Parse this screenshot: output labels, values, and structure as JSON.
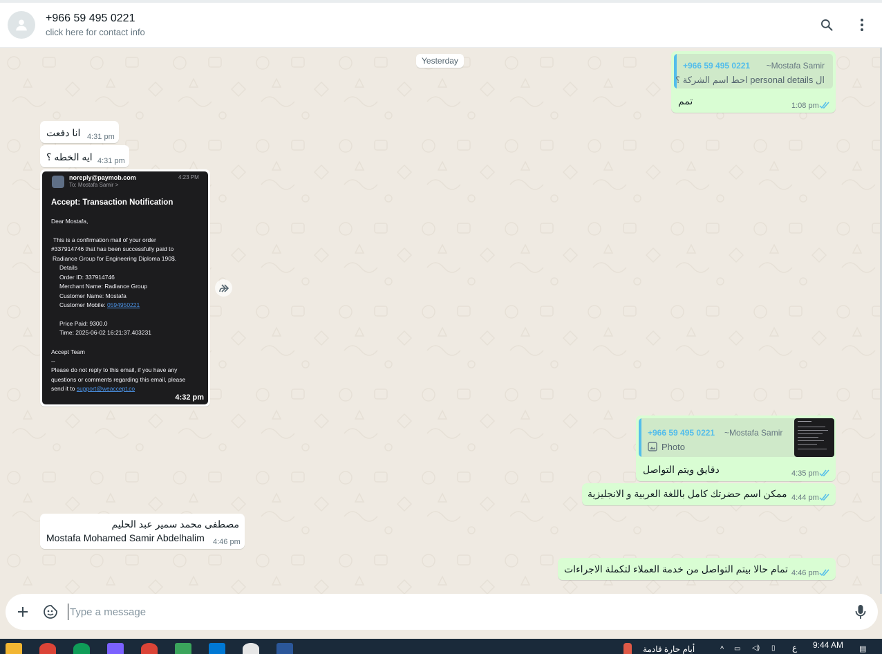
{
  "header": {
    "contact_name": "+966 59 495 0221",
    "contact_sub": "click here for contact info",
    "search_icon": "search-icon",
    "menu_icon": "kebab-menu-icon"
  },
  "chat": {
    "day_label": "Yesterday",
    "messages": [
      {
        "direction": "out",
        "quote_phone": "+966 59 495 0221",
        "quote_author": "~Mostafa Samir",
        "quote_text": "ال personal details احط اسم الشركة ؟",
        "text": "تمم",
        "time": "1:08 pm"
      },
      {
        "direction": "in",
        "text": "انا دفعت",
        "time": "4:31 pm"
      },
      {
        "direction": "in",
        "text": "ايه الخطه ؟",
        "time": "4:31 pm"
      },
      {
        "direction": "in",
        "type": "image",
        "time": "4:32 pm",
        "email": {
          "from": "noreply@paymob.com",
          "to": "To: Mostafa Samir >",
          "stamp": "4:23 PM",
          "subject": "Accept: Transaction Notification",
          "greeting": "Dear Mostafa,",
          "line1": "This is a confirmation mail of your order",
          "line2": "#337914746 that has been successfully paid to",
          "line3": "Radiance Group for Engineering Diploma 190$.",
          "details": "Details",
          "order_id": "Order ID: 337914746",
          "merchant": "Merchant Name: Radiance Group",
          "customer": "Customer Name: Mostafa",
          "mobile_label": "Customer Mobile: ",
          "mobile": "0594950221",
          "price": "Price Paid: 9300.0",
          "time_line": "Time: 2025-06-02 16:21:37.403231",
          "team": "Accept Team",
          "dashes": "--",
          "footer1": "Please do not reply to this email, if you have any",
          "footer2": "questions or comments regarding this email, please",
          "footer3": "send it to ",
          "support": "support@weaccept.co"
        }
      },
      {
        "direction": "out",
        "quote_phone": "+966 59 495 0221",
        "quote_author": "~Mostafa Samir",
        "quote_text": "Photo",
        "text": "دقايق ويتم التواصل",
        "time": "4:35 pm"
      },
      {
        "direction": "out",
        "text": "ممكن اسم حضرتك كامل باللغة العربية و الانجليزية",
        "time": "4:44 pm"
      },
      {
        "direction": "in",
        "text_line1": "مصطفى محمد سمير عبد الحليم",
        "text_line2": "Mostafa Mohamed Samir Abdelhalim",
        "time": "4:46 pm"
      },
      {
        "direction": "out",
        "text": "تمام حالا بيتم التواصل من خدمة العملاء لتكملة الاجراءات",
        "time": "4:46 pm"
      }
    ]
  },
  "composer": {
    "placeholder": "Type a message",
    "attach_icon": "plus-icon",
    "sticker_icon": "sticker-icon",
    "mic_icon": "microphone-icon"
  },
  "taskbar": {
    "weather": "أيام حارة قادمة",
    "clock": "9:44 AM",
    "lang": "ع"
  },
  "colors": {
    "outgoing_bubble": "#d9fdd3",
    "incoming_bubble": "#ffffff",
    "chat_background": "#efeae2",
    "quote_accent": "#53bdeb",
    "read_ticks": "#53bdeb"
  }
}
